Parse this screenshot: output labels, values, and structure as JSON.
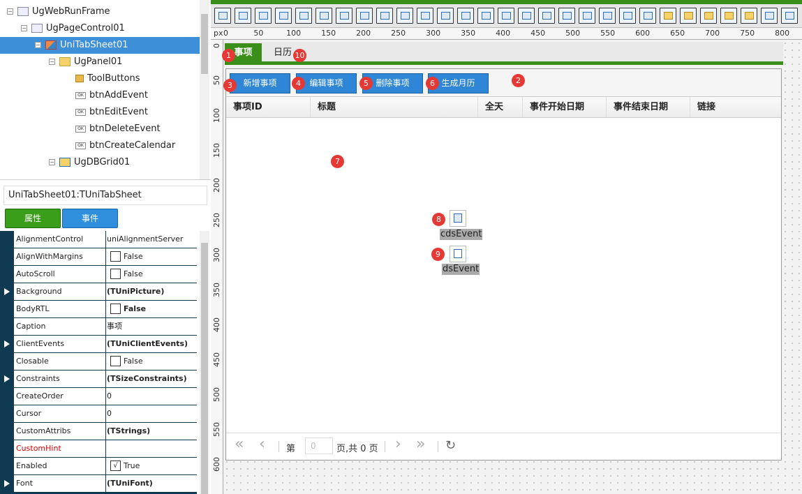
{
  "tree": {
    "nodes": [
      {
        "label": "UgWebRunFrame",
        "icon": "frame-icon"
      },
      {
        "label": "UgPageControl01",
        "icon": "page-control-icon"
      },
      {
        "label": "UniTabSheet01",
        "icon": "tabsheet-icon"
      },
      {
        "label": "UgPanel01",
        "icon": "panel-icon"
      },
      {
        "label": "ToolButtons",
        "icon": "package-icon"
      },
      {
        "label": "btnAddEvent",
        "icon": "button-icon"
      },
      {
        "label": "btnEditEvent",
        "icon": "button-icon"
      },
      {
        "label": "btnDeleteEvent",
        "icon": "button-icon"
      },
      {
        "label": "btnCreateCalendar",
        "icon": "button-icon"
      },
      {
        "label": "UgDBGrid01",
        "icon": "dbgrid-icon"
      }
    ],
    "btn_icon_text": "OK"
  },
  "inspector": {
    "object_name": "UniTabSheet01:TUniTabSheet",
    "tab_properties": "属性",
    "tab_events": "事件",
    "properties": [
      {
        "name": "AlignmentControl",
        "value": "uniAlignmentServer"
      },
      {
        "name": "AlignWithMargins",
        "value": "False",
        "check": ""
      },
      {
        "name": "AutoScroll",
        "value": "False",
        "check": ""
      },
      {
        "name": "Background",
        "value": "(TUniPicture)",
        "expand": true
      },
      {
        "name": "BodyRTL",
        "value": "False",
        "check": ""
      },
      {
        "name": "Caption",
        "value": "事项"
      },
      {
        "name": "ClientEvents",
        "value": "(TUniClientEvents)",
        "expand": true
      },
      {
        "name": "Closable",
        "value": "False",
        "check": ""
      },
      {
        "name": "Constraints",
        "value": "(TSizeConstraints)",
        "expand": true
      },
      {
        "name": "CreateOrder",
        "value": "0"
      },
      {
        "name": "Cursor",
        "value": "0"
      },
      {
        "name": "CustomAttribs",
        "value": "(TStrings)"
      },
      {
        "name": "CustomHint",
        "value": ""
      },
      {
        "name": "Enabled",
        "value": "True",
        "check": "√"
      },
      {
        "name": "Font",
        "value": "(TUniFont)",
        "expand": true
      }
    ]
  },
  "ruler": {
    "unit": "px",
    "h_labels": [
      "0",
      "50",
      "100",
      "150",
      "200",
      "250",
      "300",
      "350",
      "400",
      "450",
      "500",
      "550",
      "600",
      "650",
      "700",
      "750",
      "800"
    ],
    "v_labels": [
      "0",
      "50",
      "100",
      "150",
      "200",
      "250",
      "300",
      "350",
      "400",
      "450",
      "500",
      "550",
      "600"
    ]
  },
  "designer": {
    "tabs": [
      "事项",
      "日历"
    ],
    "buttons": [
      "新增事项",
      "编辑事项",
      "删除事项",
      "生成月历"
    ],
    "grid_columns": [
      "事项ID",
      "标题",
      "全天",
      "事件开始日期",
      "事件结束日期",
      "链接"
    ],
    "pager": {
      "first": "«",
      "prev": "‹",
      "page_label": "第",
      "page_value": "0",
      "total_text": "页,共 0 页",
      "next": "›",
      "last": "»",
      "refresh": "↻"
    },
    "components": [
      "cdsEvent",
      "dsEvent"
    ]
  },
  "badges": [
    "1",
    "2",
    "3",
    "4",
    "5",
    "6",
    "7",
    "8",
    "9",
    "10"
  ],
  "colors": {
    "accent_green": "#3a8f1a",
    "button_blue": "#2f86d6",
    "selection_blue": "#3d8fd8",
    "badge_red": "#e53935"
  }
}
